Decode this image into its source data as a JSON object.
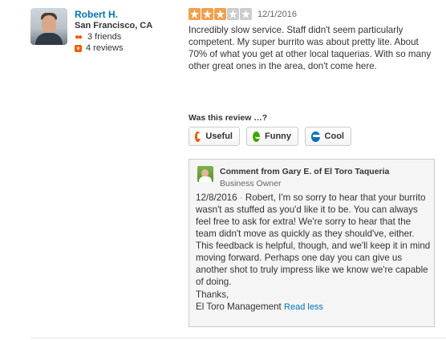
{
  "user": {
    "name": "Robert H.",
    "location": "San Francisco, CA",
    "friends": "3 friends",
    "reviews": "4 reviews"
  },
  "review": {
    "rating": 3,
    "rating_max": 5,
    "date": "12/1/2016",
    "text": "Incredibly slow service.  Staff didn't seem particularly competent.  My super burrito was about pretty lite. About 70% of what you get at other local taquerias.  With so many other great ones in the area, don't come here."
  },
  "feedback": {
    "title": "Was this review …?",
    "useful": "Useful",
    "funny": "Funny",
    "cool": "Cool"
  },
  "comment": {
    "title": "Comment from Gary E. of El Toro Taqueria",
    "role": "Business Owner",
    "date": "12/8/2016",
    "separator": "·",
    "text": "Robert, I'm so sorry to hear that your burrito wasn't as stuffed as you'd like it to be. You can always feel free to ask for extra! We're sorry to hear that the team didn't move as quickly as they should've, either. This feedback is helpful, though, and we'll keep it in mind moving forward. Perhaps one day you can give us another shot to truly impress like we know we're capable of doing.",
    "signoff": "Thanks,",
    "signature": "El Toro Management",
    "read_less": "Read less"
  },
  "colors": {
    "link": "#0073bb",
    "star_on": "#f2a04c",
    "star_off": "#cccccc",
    "useful": "#f15c00",
    "funny": "#41a700",
    "cool": "#0073bb"
  }
}
